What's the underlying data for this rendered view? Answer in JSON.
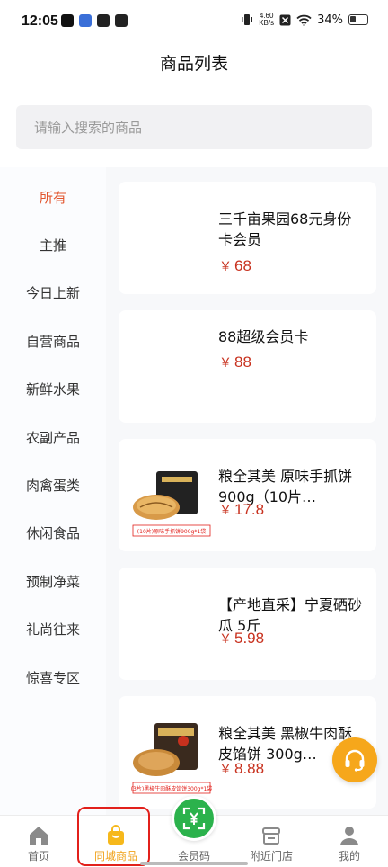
{
  "status_bar": {
    "time": "12:05",
    "net_speed": "4.60",
    "net_unit": "KB/s",
    "battery": "34%"
  },
  "header": {
    "title": "商品列表"
  },
  "search": {
    "placeholder": "请输入搜索的商品"
  },
  "categories": [
    {
      "label": "所有",
      "active": true
    },
    {
      "label": "主推"
    },
    {
      "label": "今日上新"
    },
    {
      "label": "自营商品"
    },
    {
      "label": "新鲜水果"
    },
    {
      "label": "农副产品"
    },
    {
      "label": "肉禽蛋类"
    },
    {
      "label": "休闲食品"
    },
    {
      "label": "预制净菜"
    },
    {
      "label": "礼尚往来"
    },
    {
      "label": "惊喜专区"
    }
  ],
  "products": [
    {
      "name": "三千亩果园68元身份卡会员",
      "currency": "￥",
      "price": "68",
      "has_image": false
    },
    {
      "name": "88超级会员卡",
      "currency": "￥",
      "price": "88",
      "has_image": false
    },
    {
      "name": "粮全其美 原味手抓饼 900g（10片…",
      "currency": "￥",
      "price": "17.8",
      "has_image": true,
      "image_caption": "(10片)原味手抓饼900g*1袋"
    },
    {
      "name": "【产地直采】宁夏硒砂瓜 5斤",
      "currency": "￥",
      "price": "5.98",
      "has_image": false
    },
    {
      "name": "粮全其美 黑椒牛肉酥皮馅饼 300g…",
      "currency": "￥",
      "price": "8.88",
      "has_image": true,
      "image_caption": "(3片)黑椒牛肉酥皮馅饼300g*1袋"
    }
  ],
  "bottom_nav": [
    {
      "label": "首页",
      "icon": "home-icon"
    },
    {
      "label": "同城商品",
      "icon": "shopping-bag-icon",
      "active": true
    },
    {
      "label": "会员码",
      "icon": "member-code-icon"
    },
    {
      "label": "附近门店",
      "icon": "store-icon"
    },
    {
      "label": "我的",
      "icon": "user-icon"
    }
  ],
  "colors": {
    "accent": "#e2542c",
    "price": "#c8311e",
    "nav_active": "#f0a21a",
    "fab": "#2bb24c",
    "support": "#f6a71b"
  }
}
